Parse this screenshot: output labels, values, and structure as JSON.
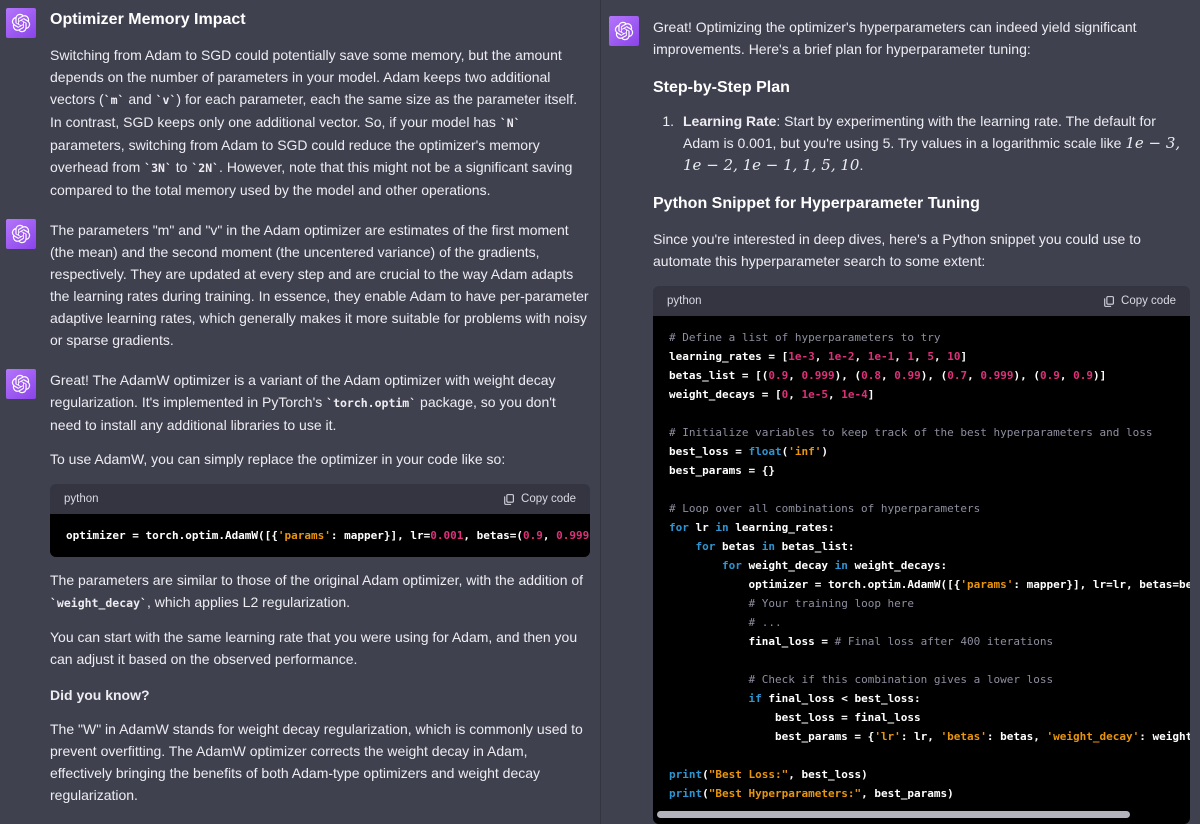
{
  "colors": {
    "page_bg": "#40414f",
    "divider": "#34353f",
    "text": "#ececf1",
    "heading": "#ffffff",
    "avatar_bg_1": "#b476fb",
    "avatar_bg_2": "#8a43ea",
    "code_bg": "#000000",
    "code_header_bg": "#343541",
    "code_header_text": "#d9d9e3",
    "code_text": "#ffffff",
    "syntax_keyword": "#2e95d3",
    "syntax_number": "#df3079",
    "syntax_string": "#e9950c",
    "syntax_comment": "#8e8ea0",
    "scrollbar": "#b3b3bd"
  },
  "left": {
    "msg1": {
      "heading": "Optimizer Memory Impact",
      "p1": [
        {
          "t": "Switching from Adam to SGD could potentially save some memory, but the amount depends on the number of parameters in your model. Adam keeps two additional vectors ("
        },
        {
          "t": "`m`",
          "c": "code"
        },
        {
          "t": " and "
        },
        {
          "t": "`v`",
          "c": "code"
        },
        {
          "t": ") for each parameter, each the same size as the parameter itself. In contrast, SGD keeps only one additional vector. So, if your model has "
        },
        {
          "t": "`N`",
          "c": "code"
        },
        {
          "t": " parameters, switching from Adam to SGD could reduce the optimizer's memory overhead from "
        },
        {
          "t": "`3N`",
          "c": "code"
        },
        {
          "t": " to "
        },
        {
          "t": "`2N`",
          "c": "code"
        },
        {
          "t": ". However, note that this might not be a significant saving compared to the total memory used by the model and other operations."
        }
      ]
    },
    "msg2": {
      "p1": [
        {
          "t": "The parameters \"m\" and \"v\" in the Adam optimizer are estimates of the first moment (the mean) and the second moment (the uncentered variance) of the gradients, respectively. They are updated at every step and are crucial to the way Adam adapts the learning rates during training. In essence, they enable Adam to have per-parameter adaptive learning rates, which generally makes it more suitable for problems with noisy or sparse gradients."
        }
      ]
    },
    "msg3": {
      "p1": [
        {
          "t": "Great! The AdamW optimizer is a variant of the Adam optimizer with weight decay regularization. It's implemented in PyTorch's "
        },
        {
          "t": "`torch.optim`",
          "c": "code"
        },
        {
          "t": " package, so you don't need to install any additional libraries to use it."
        }
      ],
      "p2": [
        {
          "t": "To use AdamW, you can simply replace the optimizer in your code like so:"
        }
      ],
      "code": {
        "lang": "python",
        "copy_label": "Copy code",
        "lines": [
          [
            {
              "t": "optimizer = torch.optim.AdamW([{"
            },
            {
              "t": "'params'",
              "c": "s"
            },
            {
              "t": ": mapper}], lr="
            },
            {
              "t": "0.001",
              "c": "n"
            },
            {
              "t": ", betas=("
            },
            {
              "t": "0.9",
              "c": "n"
            },
            {
              "t": ", "
            },
            {
              "t": "0.999",
              "c": "n"
            },
            {
              "t": "))"
            }
          ]
        ]
      },
      "p3": [
        {
          "t": "The parameters are similar to those of the original Adam optimizer, with the addition of "
        },
        {
          "t": "`weight_decay`",
          "c": "code"
        },
        {
          "t": ", which applies L2 regularization."
        }
      ],
      "p4": [
        {
          "t": "You can start with the same learning rate that you were using for Adam, and then you can adjust it based on the observed performance."
        }
      ],
      "did_you_know": "Did you know?",
      "p5": [
        {
          "t": "The \"W\" in AdamW stands for weight decay regularization, which is commonly used to prevent overfitting. The AdamW optimizer corrects the weight decay in Adam, effectively bringing the benefits of both Adam-type optimizers and weight decay regularization."
        }
      ]
    }
  },
  "right": {
    "msg": {
      "p1": [
        {
          "t": "Great! Optimizing the optimizer's hyperparameters can indeed yield significant improvements. Here's a brief plan for hyperparameter tuning:"
        }
      ],
      "h1": "Step-by-Step Plan",
      "list_item": {
        "marker": "1.",
        "segments": [
          {
            "t": "Learning Rate",
            "c": "b"
          },
          {
            "t": ": Start by experimenting with the learning rate. The default for Adam is 0.001, but you're using 5. Try values in a logarithmic scale like "
          },
          {
            "t": "1e − 3, 1e − 2, 1e − 1, 1, 5, 10",
            "c": "math"
          },
          {
            "t": "."
          }
        ]
      },
      "h2": "Python Snippet for Hyperparameter Tuning",
      "p2": [
        {
          "t": "Since you're interested in deep dives, here's a Python snippet you could use to automate this hyperparameter search to some extent:"
        }
      ],
      "code": {
        "lang": "python",
        "copy_label": "Copy code",
        "lines": [
          [
            {
              "t": "# Define a list of hyperparameters to try",
              "c": "c"
            }
          ],
          [
            {
              "t": "learning_rates = ["
            },
            {
              "t": "1e-3",
              "c": "n"
            },
            {
              "t": ", "
            },
            {
              "t": "1e-2",
              "c": "n"
            },
            {
              "t": ", "
            },
            {
              "t": "1e-1",
              "c": "n"
            },
            {
              "t": ", "
            },
            {
              "t": "1",
              "c": "n"
            },
            {
              "t": ", "
            },
            {
              "t": "5",
              "c": "n"
            },
            {
              "t": ", "
            },
            {
              "t": "10",
              "c": "n"
            },
            {
              "t": "]"
            }
          ],
          [
            {
              "t": "betas_list = [("
            },
            {
              "t": "0.9",
              "c": "n"
            },
            {
              "t": ", "
            },
            {
              "t": "0.999",
              "c": "n"
            },
            {
              "t": "), ("
            },
            {
              "t": "0.8",
              "c": "n"
            },
            {
              "t": ", "
            },
            {
              "t": "0.99",
              "c": "n"
            },
            {
              "t": "), ("
            },
            {
              "t": "0.7",
              "c": "n"
            },
            {
              "t": ", "
            },
            {
              "t": "0.999",
              "c": "n"
            },
            {
              "t": "), ("
            },
            {
              "t": "0.9",
              "c": "n"
            },
            {
              "t": ", "
            },
            {
              "t": "0.9",
              "c": "n"
            },
            {
              "t": ")]"
            }
          ],
          [
            {
              "t": "weight_decays = ["
            },
            {
              "t": "0",
              "c": "n"
            },
            {
              "t": ", "
            },
            {
              "t": "1e-5",
              "c": "n"
            },
            {
              "t": ", "
            },
            {
              "t": "1e-4",
              "c": "n"
            },
            {
              "t": "]"
            }
          ],
          [],
          [
            {
              "t": "# Initialize variables to keep track of the best hyperparameters and loss",
              "c": "c"
            }
          ],
          [
            {
              "t": "best_loss = "
            },
            {
              "t": "float",
              "c": "k"
            },
            {
              "t": "("
            },
            {
              "t": "'inf'",
              "c": "s"
            },
            {
              "t": ")"
            }
          ],
          [
            {
              "t": "best_params = {}"
            }
          ],
          [],
          [
            {
              "t": "# Loop over all combinations of hyperparameters",
              "c": "c"
            }
          ],
          [
            {
              "t": "for",
              "c": "k"
            },
            {
              "t": " lr "
            },
            {
              "t": "in",
              "c": "k"
            },
            {
              "t": " learning_rates:"
            }
          ],
          [
            {
              "t": "    "
            },
            {
              "t": "for",
              "c": "k"
            },
            {
              "t": " betas "
            },
            {
              "t": "in",
              "c": "k"
            },
            {
              "t": " betas_list:"
            }
          ],
          [
            {
              "t": "        "
            },
            {
              "t": "for",
              "c": "k"
            },
            {
              "t": " weight_decay "
            },
            {
              "t": "in",
              "c": "k"
            },
            {
              "t": " weight_decays:"
            }
          ],
          [
            {
              "t": "            optimizer = torch.optim.AdamW([{"
            },
            {
              "t": "'params'",
              "c": "s"
            },
            {
              "t": ": mapper}], lr=lr, betas=betas, weight_decay=weight_decay)"
            }
          ],
          [
            {
              "t": "            "
            },
            {
              "t": "# Your training loop here",
              "c": "c"
            }
          ],
          [
            {
              "t": "            "
            },
            {
              "t": "# ...",
              "c": "c"
            }
          ],
          [
            {
              "t": "            final_loss = "
            },
            {
              "t": "# Final loss after 400 iterations",
              "c": "c"
            }
          ],
          [],
          [
            {
              "t": "            "
            },
            {
              "t": "# Check if this combination gives a lower loss",
              "c": "c"
            }
          ],
          [
            {
              "t": "            "
            },
            {
              "t": "if",
              "c": "k"
            },
            {
              "t": " final_loss < best_loss:"
            }
          ],
          [
            {
              "t": "                best_loss = final_loss"
            }
          ],
          [
            {
              "t": "                best_params = {"
            },
            {
              "t": "'lr'",
              "c": "s"
            },
            {
              "t": ": lr, "
            },
            {
              "t": "'betas'",
              "c": "s"
            },
            {
              "t": ": betas, "
            },
            {
              "t": "'weight_decay'",
              "c": "s"
            },
            {
              "t": ": weight_decay}"
            }
          ],
          [],
          [
            {
              "t": "print",
              "c": "k"
            },
            {
              "t": "("
            },
            {
              "t": "\"Best Loss:\"",
              "c": "s"
            },
            {
              "t": ", best_loss)"
            }
          ],
          [
            {
              "t": "print",
              "c": "k"
            },
            {
              "t": "("
            },
            {
              "t": "\"Best Hyperparameters:\"",
              "c": "s"
            },
            {
              "t": ", best_params)"
            }
          ]
        ]
      }
    }
  }
}
